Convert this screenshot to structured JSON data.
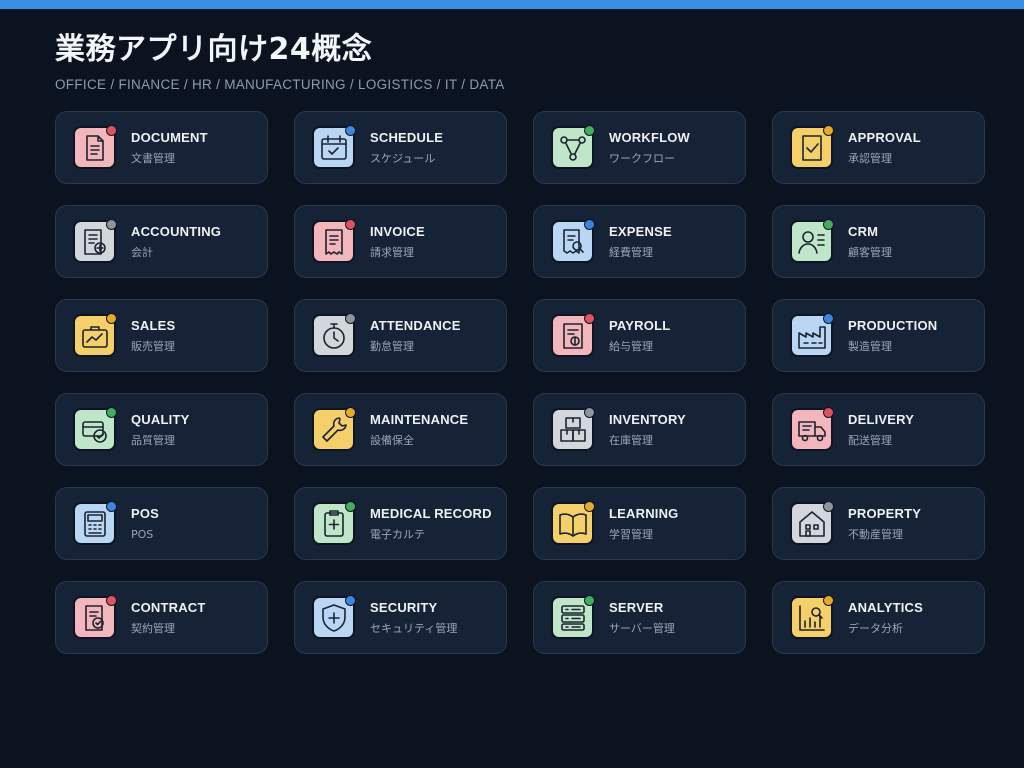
{
  "header": {
    "title": "業務アプリ向け24概念",
    "subtitle": "OFFICE / FINANCE / HR / MANUFACTURING / LOGISTICS / IT / DATA"
  },
  "colors": {
    "background": "#0b1220",
    "card": "#162235",
    "accent_bar": "#3a8ee6",
    "pink": "#f3b6bd",
    "blue": "#b9d7f5",
    "green": "#bfe6c8",
    "yellow": "#f4cf6a",
    "gray": "#d3d6db",
    "dot_red": "#e0535e",
    "dot_blue": "#3b86e0",
    "dot_green": "#3fae5e",
    "dot_yellow": "#e8a927",
    "dot_gray": "#8f949c"
  },
  "cards": [
    {
      "en": "DOCUMENT",
      "ja": "文書管理",
      "icon": "document-icon",
      "tile": "pink",
      "dot": "dot_red"
    },
    {
      "en": "SCHEDULE",
      "ja": "スケジュール",
      "icon": "calendar-icon",
      "tile": "blue",
      "dot": "dot_blue"
    },
    {
      "en": "WORKFLOW",
      "ja": "ワークフロー",
      "icon": "workflow-icon",
      "tile": "green",
      "dot": "dot_green"
    },
    {
      "en": "APPROVAL",
      "ja": "承認管理",
      "icon": "approval-icon",
      "tile": "yellow",
      "dot": "dot_yellow"
    },
    {
      "en": "ACCOUNTING",
      "ja": "会計",
      "icon": "ledger-icon",
      "tile": "gray",
      "dot": "dot_gray"
    },
    {
      "en": "INVOICE",
      "ja": "請求管理",
      "icon": "invoice-icon",
      "tile": "pink",
      "dot": "dot_red"
    },
    {
      "en": "EXPENSE",
      "ja": "経費管理",
      "icon": "receipt-search-icon",
      "tile": "blue",
      "dot": "dot_blue"
    },
    {
      "en": "CRM",
      "ja": "顧客管理",
      "icon": "customer-icon",
      "tile": "green",
      "dot": "dot_green"
    },
    {
      "en": "SALES",
      "ja": "販売管理",
      "icon": "briefcase-chart-icon",
      "tile": "yellow",
      "dot": "dot_yellow"
    },
    {
      "en": "ATTENDANCE",
      "ja": "勤怠管理",
      "icon": "stopwatch-icon",
      "tile": "gray",
      "dot": "dot_gray"
    },
    {
      "en": "PAYROLL",
      "ja": "給与管理",
      "icon": "payslip-icon",
      "tile": "pink",
      "dot": "dot_red"
    },
    {
      "en": "PRODUCTION",
      "ja": "製造管理",
      "icon": "factory-icon",
      "tile": "blue",
      "dot": "dot_blue"
    },
    {
      "en": "QUALITY",
      "ja": "品質管理",
      "icon": "quality-check-icon",
      "tile": "green",
      "dot": "dot_green"
    },
    {
      "en": "MAINTENANCE",
      "ja": "設備保全",
      "icon": "wrench-icon",
      "tile": "yellow",
      "dot": "dot_yellow"
    },
    {
      "en": "INVENTORY",
      "ja": "在庫管理",
      "icon": "boxes-icon",
      "tile": "gray",
      "dot": "dot_gray"
    },
    {
      "en": "DELIVERY",
      "ja": "配送管理",
      "icon": "truck-icon",
      "tile": "pink",
      "dot": "dot_red"
    },
    {
      "en": "POS",
      "ja": "POS",
      "icon": "register-icon",
      "tile": "blue",
      "dot": "dot_blue"
    },
    {
      "en": "MEDICAL RECORD",
      "ja": "電子カルテ",
      "icon": "medical-record-icon",
      "tile": "green",
      "dot": "dot_green"
    },
    {
      "en": "LEARNING",
      "ja": "学習管理",
      "icon": "book-icon",
      "tile": "yellow",
      "dot": "dot_yellow"
    },
    {
      "en": "PROPERTY",
      "ja": "不動産管理",
      "icon": "building-icon",
      "tile": "gray",
      "dot": "dot_gray"
    },
    {
      "en": "CONTRACT",
      "ja": "契約管理",
      "icon": "contract-icon",
      "tile": "pink",
      "dot": "dot_red"
    },
    {
      "en": "SECURITY",
      "ja": "セキュリティ管理",
      "icon": "shield-icon",
      "tile": "blue",
      "dot": "dot_blue"
    },
    {
      "en": "SERVER",
      "ja": "サーバー管理",
      "icon": "server-icon",
      "tile": "green",
      "dot": "dot_green"
    },
    {
      "en": "ANALYTICS",
      "ja": "データ分析",
      "icon": "analytics-icon",
      "tile": "yellow",
      "dot": "dot_yellow"
    }
  ]
}
